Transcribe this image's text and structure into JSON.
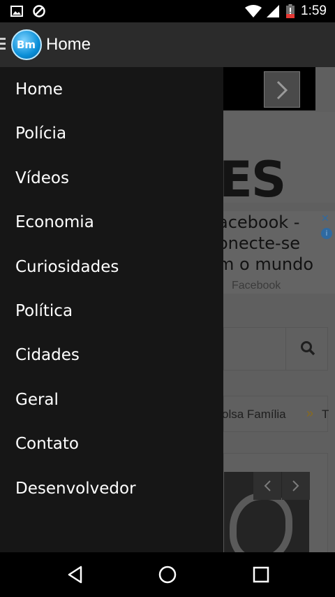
{
  "status_bar": {
    "time": "1:59",
    "icons": [
      "gallery-icon",
      "blocked-icon",
      "wifi-icon",
      "signal-icon",
      "battery-icon"
    ]
  },
  "app_bar": {
    "logo_text": "Bm",
    "title": "Home"
  },
  "drawer": {
    "items": [
      {
        "label": "Home"
      },
      {
        "label": "Polícia"
      },
      {
        "label": "Vídeos"
      },
      {
        "label": "Economia"
      },
      {
        "label": "Curiosidades"
      },
      {
        "label": "Política"
      },
      {
        "label": "Cidades"
      },
      {
        "label": "Geral"
      },
      {
        "label": "Contato"
      },
      {
        "label": "Desenvolvedor"
      }
    ]
  },
  "background": {
    "logo_fragment": "ES",
    "ad": {
      "line1": "acebook -",
      "line2": "onecte-se",
      "line3": "m o mundo",
      "source": "Facebook"
    },
    "ticker": {
      "text": "olsa Família",
      "arrows": "»",
      "extra": "T"
    }
  },
  "colors": {
    "drawer_bg": "#161616",
    "appbar_bg": "#2b2b2b",
    "logo_blue": "#0a8fd8"
  }
}
